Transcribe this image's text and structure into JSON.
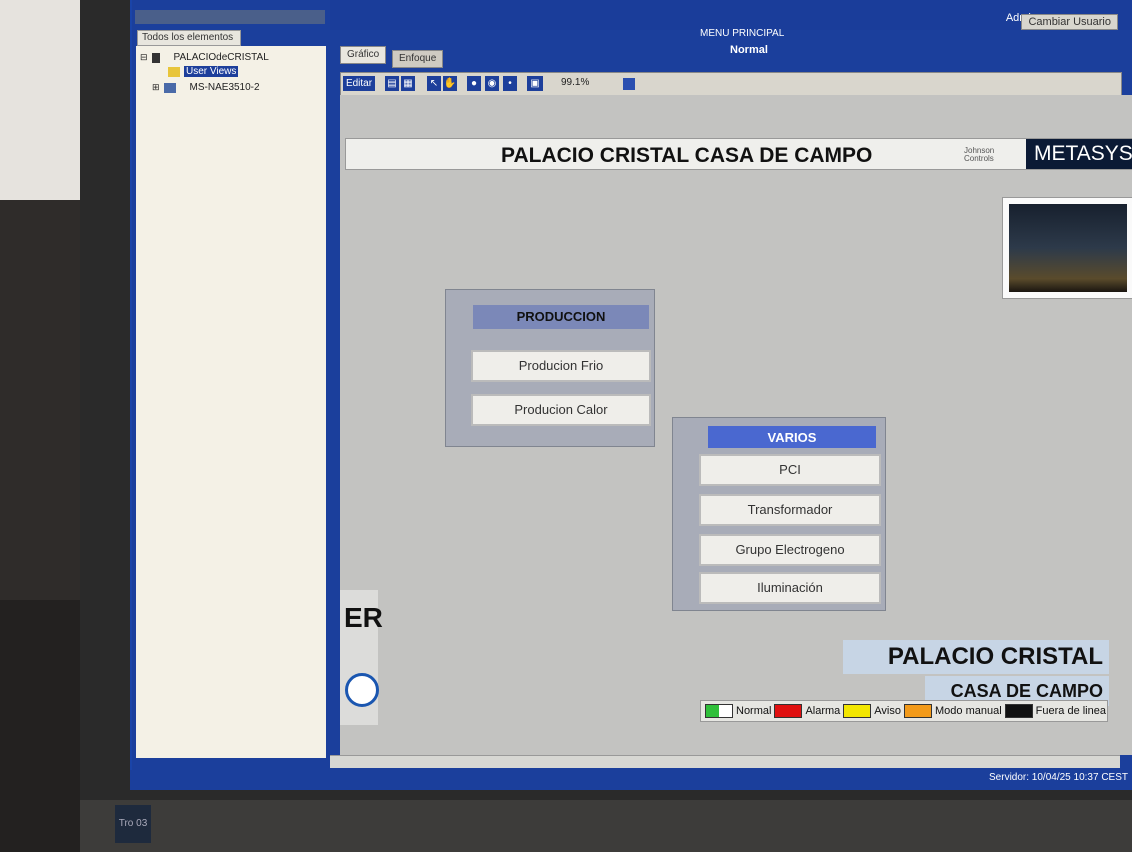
{
  "left_tree": {
    "tab_label": "Todos los elementos",
    "items": [
      {
        "label": "PALACIOdeCRISTAL"
      },
      {
        "label": "User Views"
      },
      {
        "label": "MS-NAE3510-2"
      }
    ]
  },
  "header": {
    "user": "Admin",
    "change_user": "Cambiar Usuario",
    "menu_title": "MENU PRINCIPAL",
    "status": "Normal",
    "tabs": [
      {
        "label": "Gráfico"
      },
      {
        "label": "Enfoque"
      }
    ]
  },
  "toolbar": {
    "edit_label": "Editar",
    "zoom": "99.1%"
  },
  "canvas": {
    "banner_title": "PALACIO CRISTAL CASA DE CAMPO",
    "brand_jc_line1": "Johnson",
    "brand_jc_line2": "Controls",
    "brand_metasys": "METASYS",
    "produccion": {
      "title": "PRODUCCION",
      "buttons": [
        "Producion Frio",
        "Producion Calor"
      ]
    },
    "varios": {
      "title": "VARIOS",
      "buttons": [
        "PCI",
        "Transformador",
        "Grupo Electrogeno",
        "Iluminación"
      ]
    },
    "logo_er": "ER",
    "big_title_1": "PALACIO CRISTAL",
    "big_title_2": "CASA DE CAMPO",
    "legend": [
      {
        "label": "Normal",
        "color": "#2fbf3a"
      },
      {
        "label": "Alarma",
        "color": "#e01010"
      },
      {
        "label": "Aviso",
        "color": "#f2e600"
      },
      {
        "label": "Modo manual",
        "color": "#f29a1a"
      },
      {
        "label": "Fuera de linea",
        "color": "#111111"
      }
    ]
  },
  "statusbar": {
    "server": "Servidor: 10/04/25 10:37 CEST"
  },
  "monitor_sticker": "Tro 03"
}
